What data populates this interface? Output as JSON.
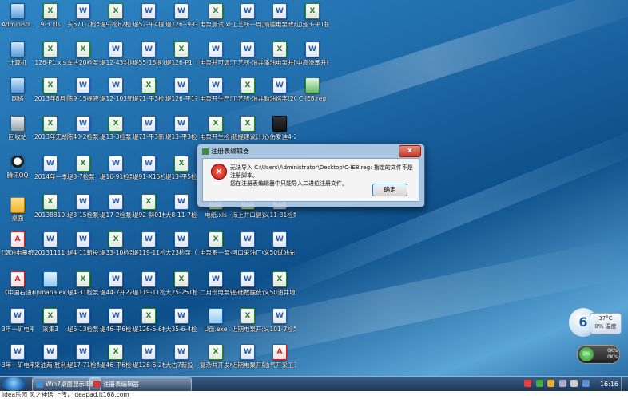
{
  "desktop": {
    "columns": [
      [
        "Administr…",
        "计算机",
        "网络",
        "回收站",
        "腾讯QQ",
        "桌面",
        "[潮油电量统计术服务手…",
        "《中国石油和化工行…",
        "3年一矿电率并组票汇…",
        "3年一矿电率并组票汇…"
      ],
      [
        "9-3.xls",
        "126-P1.xls",
        "2013年8月电影与运行状…",
        "2013年无故推路开.xls",
        "2014年一季度电系统…",
        "20138810…",
        "201311111…",
        "ipmana.exe",
        "采集3",
        "采油两-胜利油田采油…"
      ],
      [
        "东571-7检泵设计2013…",
        "车古20检泵（2013.…",
        "陈9-15提液（2014.1.14…",
        "陈40-2检泵（2014.0…",
        "堤3-7检泵（2013.8.10…",
        "堤3-15检泵（2013.2…",
        "堤4-11新投（2014.01…",
        "堤4-31检泵（2010.0…",
        "堤6-13检泵（2013.…",
        "堤17-71检泵（2013.…"
      ],
      [
        "堤9-检82检泵（2013.…",
        "堤12-43封堵隔层检泵2…",
        "堤12-103新投（2013.…",
        "堤13-3检泵（2014.0…",
        "堤16-91检泵（2014.02…",
        "堤17-2检泵（2013.0…",
        "堤33-10检泵（2014.02…",
        "堤44-7开22措施（2014.6.d…",
        "堤46-平6检泵（2014.0…",
        "堤46-平6检泵设计（2014…"
      ],
      [
        "堤52-平4提液（2013.…",
        "堤55-15提液（2014.1.9…",
        "堤71-平3检泵（2013.…",
        "堤71-平3新投（2014.0…",
        "堤91-X15检泵（2014.…",
        "堤92-斜01检泵（2013.…",
        "堤119-11检泵（2014.…",
        "堤119-11检测（2013.…",
        "堤126-5-6检修置防砂检…",
        "堤126-6-2检泵（2014.…"
      ],
      [
        "堤126--9-G7提液（2013…",
        "堤126-P1（2014.03.2…",
        "堤126-平1开电系科计划…",
        "堤13-平3检泵（2013.…",
        "堤13-平5检泵（2014.0…",
        "大8-11-7检泵（2013.…",
        "大23检泵（2013.04.…",
        "大25-251检泵（2014…",
        "大35-6-4检泵（2014…",
        "大古7新投（14.02.23…"
      ],
      [
        "电泵测试.xls",
        "电泵并可调油嘴现场…",
        "电泵开生产测试配套统…",
        "电泵开生检合成.xls",
        "",
        "电纸.xls",
        "电泵系一泵多控系统…",
        "二月份电泵管理统计…",
        "U盘.exe",
        "复杂井开发电泵并组票…"
      ],
      [
        "工艺所一周工作小结…",
        "工艺所-油井套压自动…",
        "工艺所-油井套压自动…",
        "我提建议计划.xls",
        "",
        "海上并口健置构成及…",
        "河口采油厂电泵整理…",
        "基础数据统计调查(201…",
        "近期电泵开汇总.xls",
        "近期电泵开躺并分析…"
      ],
      [
        "晴德电泵政建御物表型…",
        "潘油电泵并压变频检…",
        "勤油巡字(2012)37…",
        "心伤爱迪4-2",
        "",
        "义11-31检泵（2013.0…",
        "义50试油先下保生产…",
        "义50油井地质设计.XLS",
        "义101-7检泵（2013.…",
        "油气开采工艺维护手册.pdf"
      ],
      [
        "边泓3-平1提液（2013…",
        "中高渗苯升技术调研…",
        "C-IE8.reg",
        "",
        "",
        "",
        "",
        "",
        "",
        ""
      ]
    ]
  },
  "dialog": {
    "title": "注册表编辑器",
    "message_line1": "无法导入 C:\\Users\\Administrator\\Desktop\\C-IE8.reg: 指定的文件不是注册脚本。",
    "message_line2": "您在注册表编辑器中只能导入二进位注册文件。",
    "ok_label": "确定",
    "close_label": "x",
    "error_glyph": "×"
  },
  "weather": {
    "temp": "37°C",
    "sub": "0% 温度",
    "badge": "6"
  },
  "network": {
    "dot": "0%",
    "up": "0K/s",
    "down": "0K/s"
  },
  "taskbar": {
    "buttons": [
      {
        "label": "Win7桌面显示IE8图…"
      },
      {
        "label": "注册表编辑器"
      }
    ],
    "clock": "16:16"
  },
  "watermark": "idea乐园 风之神话 上传，ideapad.it168.com",
  "colors": {
    "accent": "#1e6aa8",
    "error": "#c0140a",
    "taskbar": "#1b3555"
  }
}
